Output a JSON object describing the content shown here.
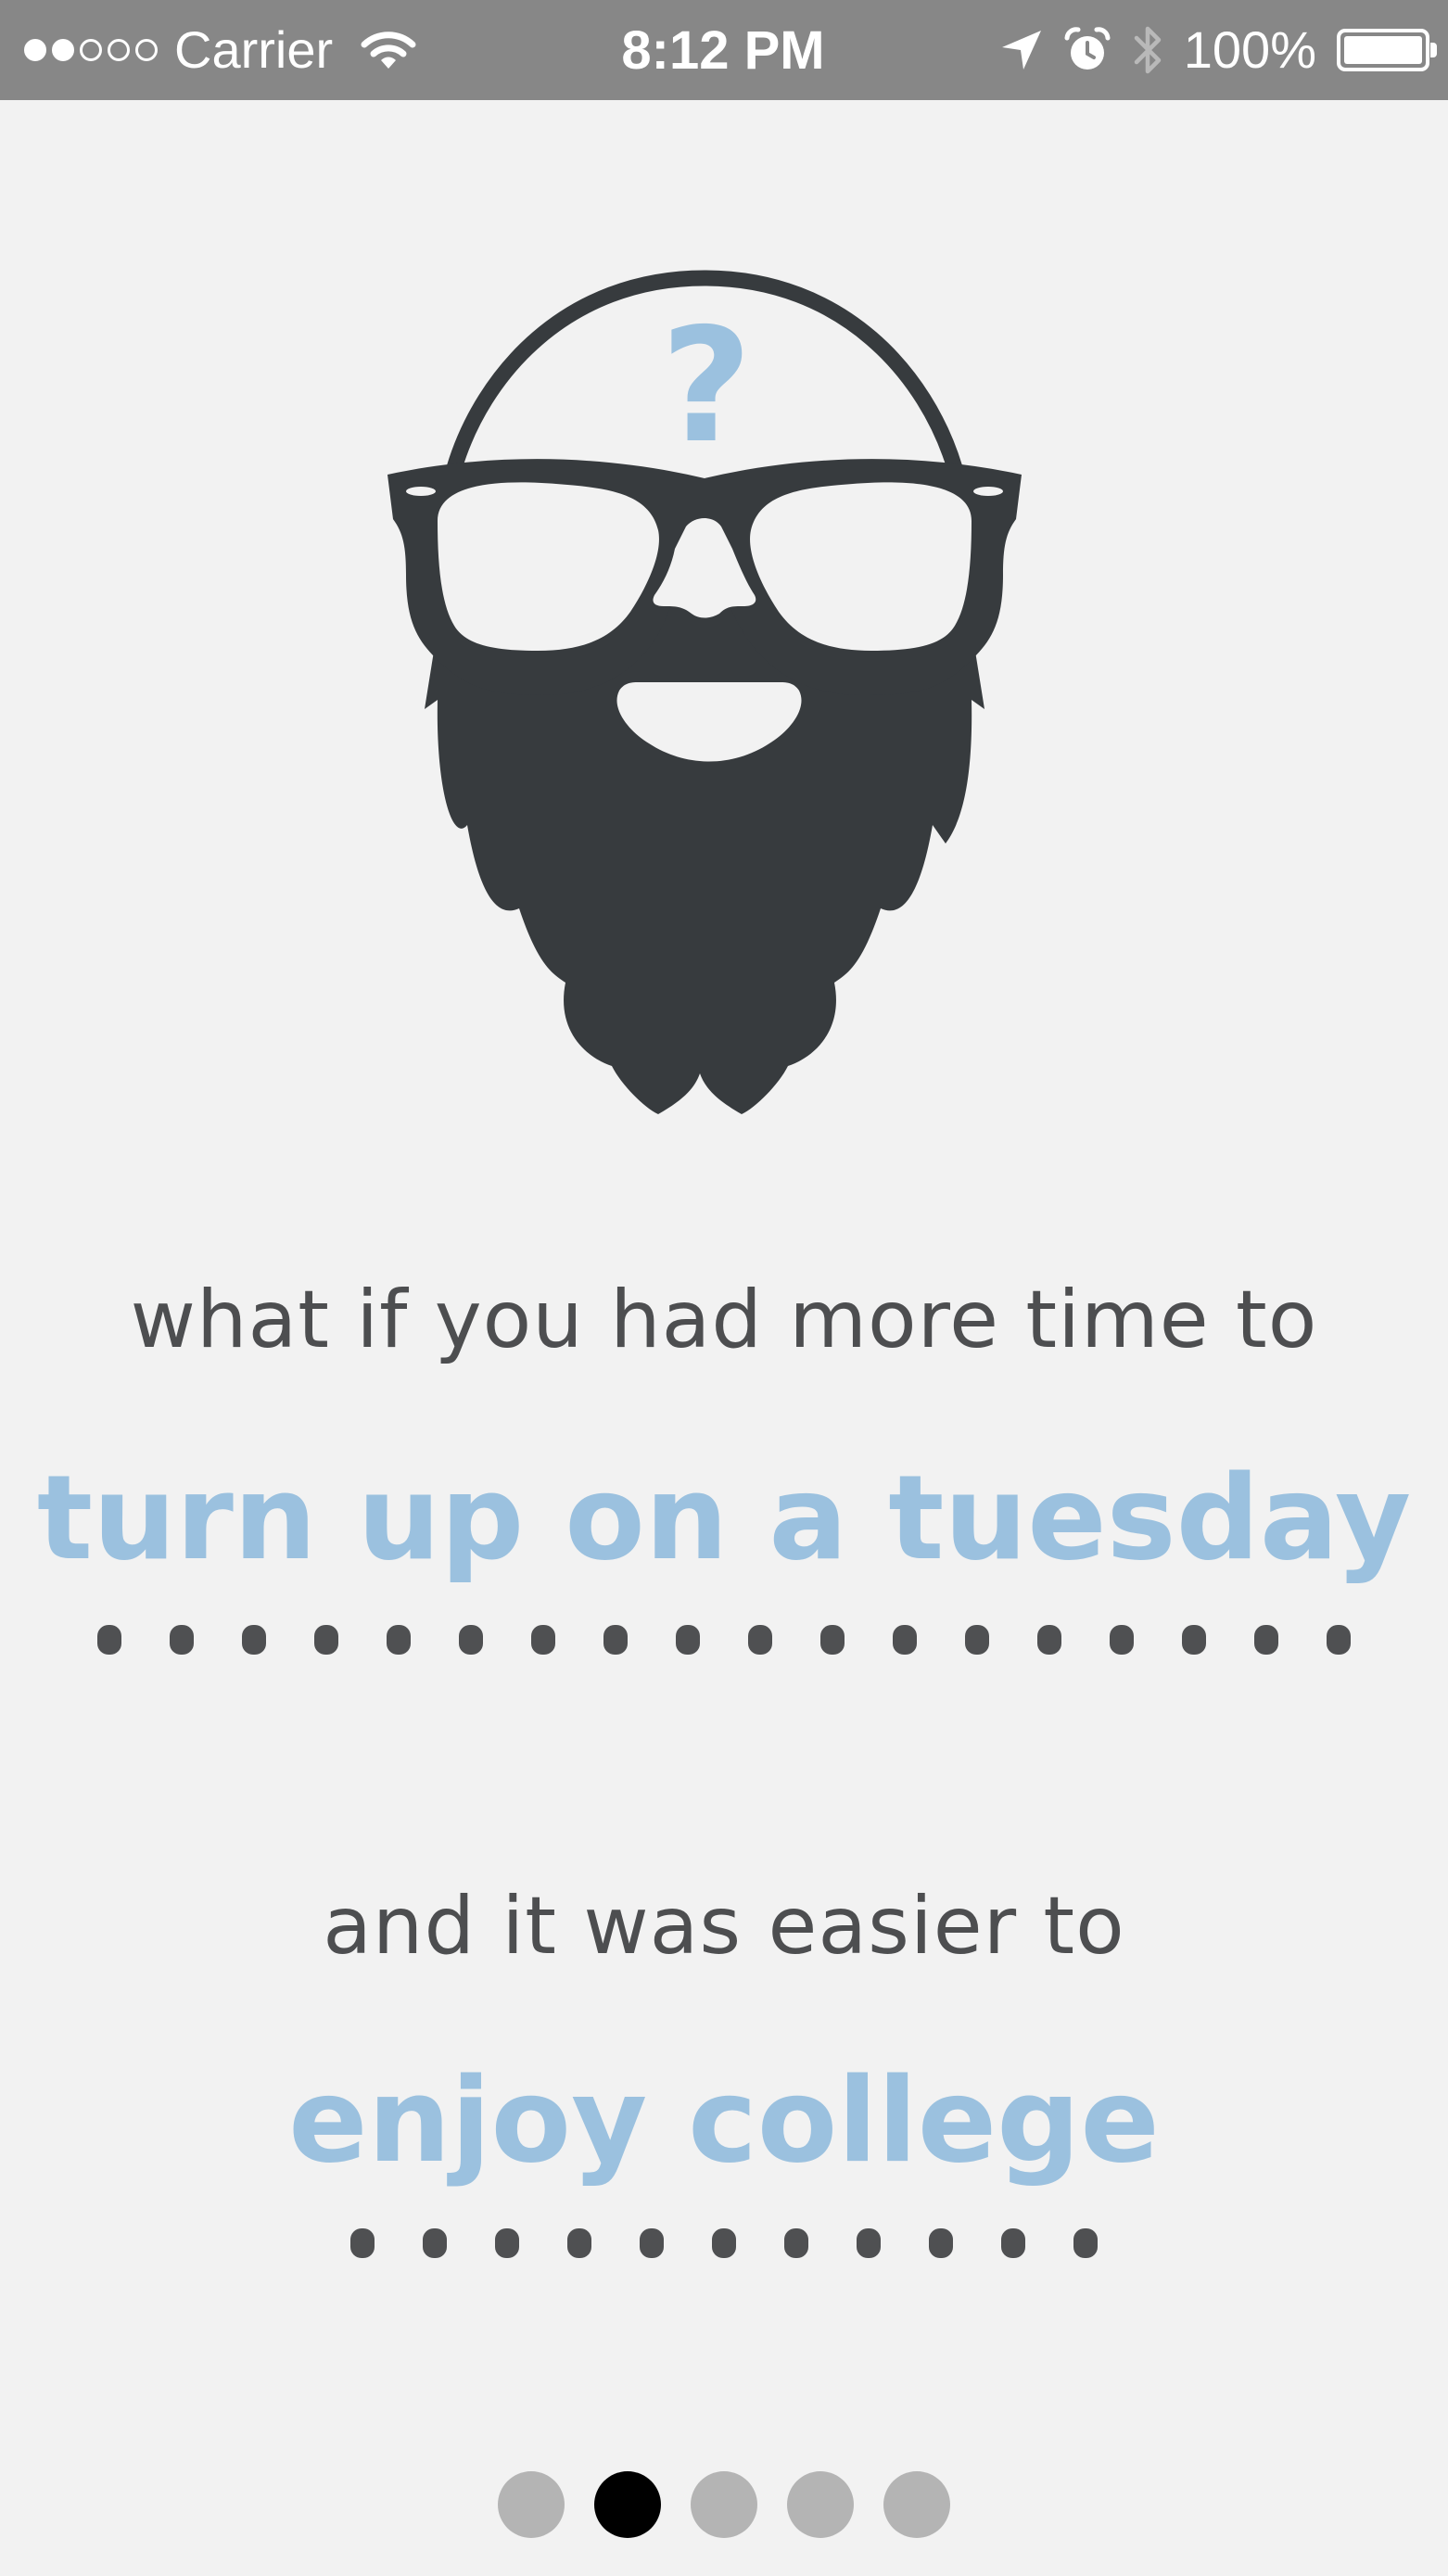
{
  "status_bar": {
    "carrier": "Carrier",
    "time": "8:12 PM",
    "battery_percent": "100%",
    "signal_bars_filled": 2,
    "signal_bars_total": 5,
    "battery_level": 1.0,
    "icons": [
      "wifi-icon",
      "location-arrow-icon",
      "alarm-icon",
      "bluetooth-icon",
      "battery-icon"
    ]
  },
  "illustration": {
    "name": "bearded-face-with-question-mark",
    "mark": "?",
    "colors": {
      "face": "#373b3e",
      "accent": "#9bc1df"
    }
  },
  "lines": [
    {
      "prompt": "what if you had more time to",
      "highlight": "turn up on a tuesday",
      "dot_count": 18
    },
    {
      "prompt": "and it was easier to",
      "highlight": "enjoy college",
      "dot_count": 11
    }
  ],
  "pager": {
    "count": 5,
    "active_index": 1
  },
  "colors": {
    "background": "#f2f2f2",
    "status_bar": "#878787",
    "prompt_text": "#4d4e50",
    "highlight_text": "#9bc1df",
    "dots": "#4f5052",
    "pager_inactive": "#b4b4b4",
    "pager_active": "#000000"
  }
}
